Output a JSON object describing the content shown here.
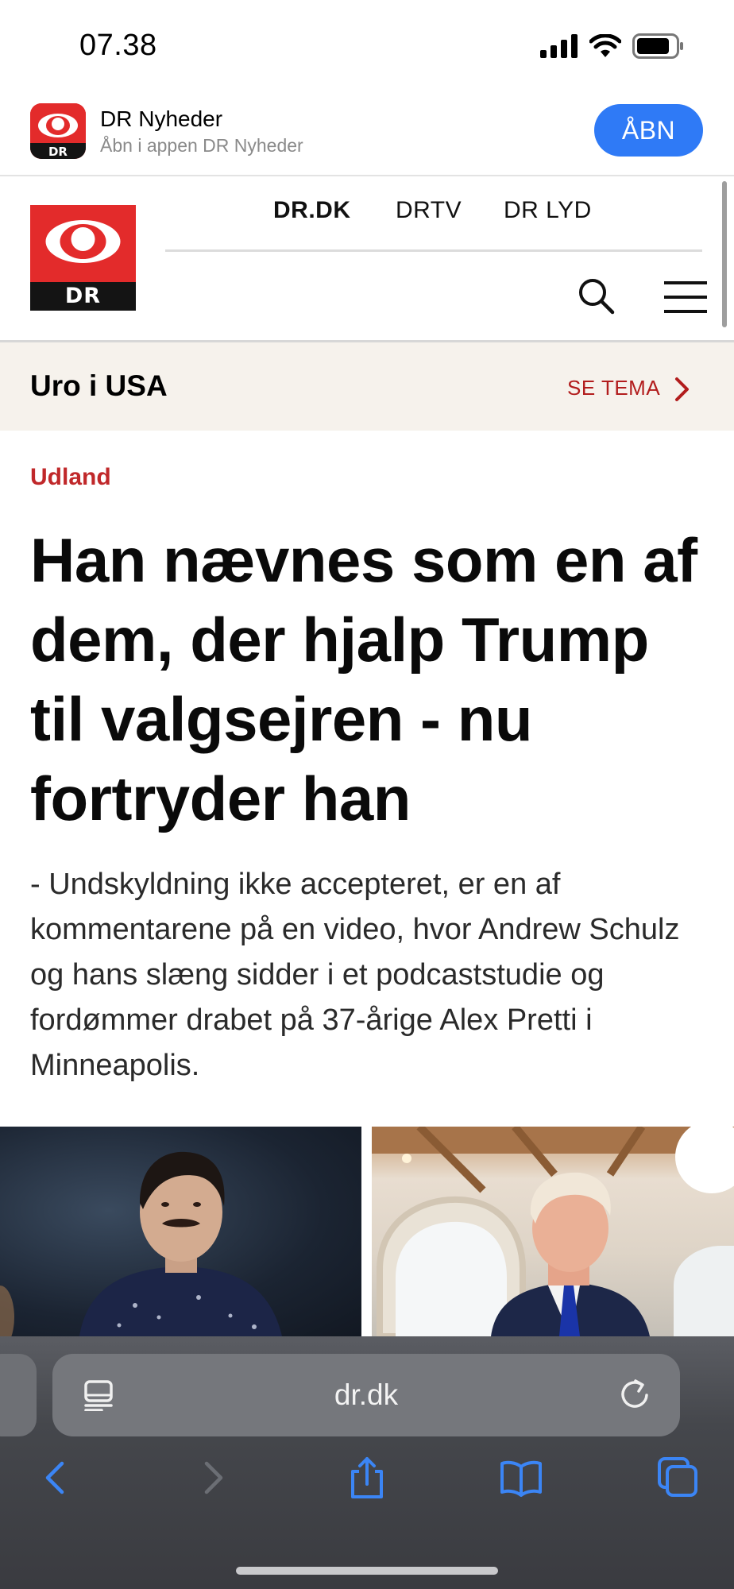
{
  "status_bar": {
    "time": "07.38"
  },
  "app_banner": {
    "name": "DR Nyheder",
    "subtitle": "Åbn i appen DR Nyheder",
    "open_label": "ÅBN"
  },
  "header": {
    "logo_text": "DR",
    "nav": [
      "DR.DK",
      "DRTV",
      "DR LYD"
    ]
  },
  "theme": {
    "title": "Uro i USA",
    "link_label": "SE TEMA"
  },
  "article": {
    "kicker": "Udland",
    "headline": "Han nævnes som en af dem, der hjalp Trump til valgsejren - nu fortryder han",
    "summary": "- Undskyldning ikke accepteret, er en af kommentarene på en video, hvor Andrew Schulz og hans slæng sidder i et podcaststudie og fordømmer drabet på 37-årige Alex Pretti i Minneapolis."
  },
  "browser": {
    "url": "dr.dk"
  },
  "colors": {
    "dr_red": "#e32b2b",
    "link_red": "#b21d1d",
    "safari_blue": "#2f7af6"
  }
}
